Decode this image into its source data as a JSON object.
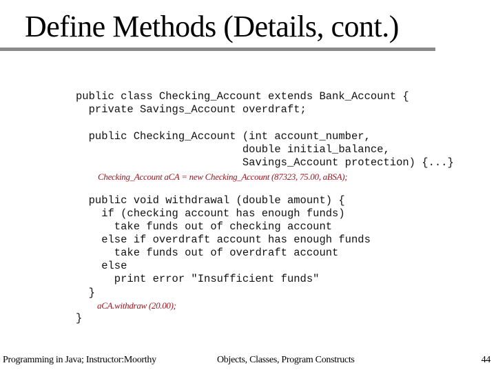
{
  "slide": {
    "title": "Define Methods (Details, cont.)",
    "code": {
      "line1": "public class Checking_Account extends Bank_Account {",
      "line2": "  private Savings_Account overdraft;",
      "line3": "  public Checking_Account (int account_number,",
      "line4": "                          double initial_balance,",
      "line5": "                          Savings_Account protection) {...}",
      "line6": "  public void withdrawal (double amount) {",
      "line7": "    if (checking account has enough funds)",
      "line8": "      take funds out of checking account",
      "line9": "    else if overdraft account has enough funds",
      "line10": "      take funds out of overdraft account",
      "line11": "    else",
      "line12": "      print error \"Insufficient funds\"",
      "line13": "  }",
      "line14": "}"
    },
    "annotations": {
      "constructor_call": "Checking_Account aCA = new Checking_Account (87323, 75.00, aBSA);",
      "withdraw_call": "aCA.withdraw (20.00);"
    },
    "colors": {
      "annotation": "#a0141e",
      "title_rule": "#8a8a8a"
    },
    "footer": {
      "course": "Programming in Java; Instructor:Moorthy",
      "topic": "Objects, Classes, Program Constructs",
      "page_number": "44"
    }
  }
}
